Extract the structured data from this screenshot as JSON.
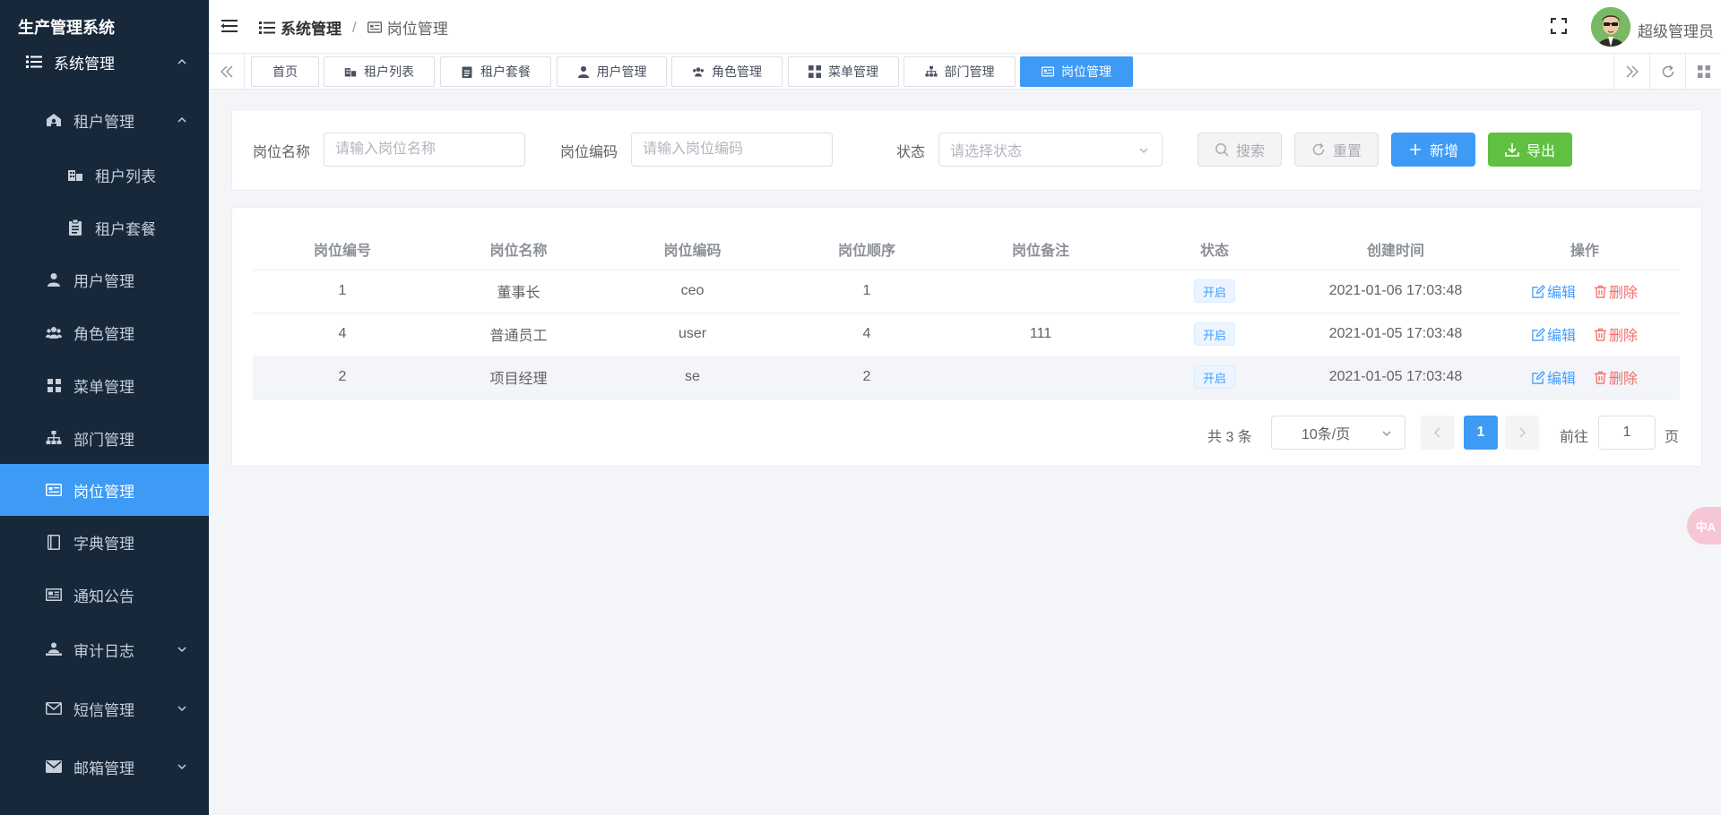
{
  "app": {
    "title": "生产管理系统"
  },
  "sidebar": {
    "top_menu": {
      "label": "系统管理"
    },
    "items": [
      {
        "id": "tenant",
        "label": "租户管理",
        "icon": "tenant-icon"
      },
      {
        "id": "tenant-list",
        "label": "租户列表",
        "icon": "tenant-list-icon"
      },
      {
        "id": "tenant-package",
        "label": "租户套餐",
        "icon": "clipboard-icon"
      },
      {
        "id": "user",
        "label": "用户管理",
        "icon": "user-icon"
      },
      {
        "id": "role",
        "label": "角色管理",
        "icon": "peoples-icon"
      },
      {
        "id": "menu",
        "label": "菜单管理",
        "icon": "grid-icon"
      },
      {
        "id": "dept",
        "label": "部门管理",
        "icon": "tree-icon"
      },
      {
        "id": "post",
        "label": "岗位管理",
        "icon": "post-icon"
      },
      {
        "id": "dict",
        "label": "字典管理",
        "icon": "dict-icon"
      },
      {
        "id": "notice",
        "label": "通知公告",
        "icon": "notice-icon"
      },
      {
        "id": "audit",
        "label": "审计日志",
        "icon": "log-icon"
      },
      {
        "id": "sms",
        "label": "短信管理",
        "icon": "message-icon"
      },
      {
        "id": "mail",
        "label": "邮箱管理",
        "icon": "email-icon"
      }
    ]
  },
  "header": {
    "breadcrumb": [
      "系统管理",
      "岗位管理"
    ],
    "breadcrumb_sep": "/",
    "username": "超级管理员"
  },
  "tags": [
    {
      "label": "首页",
      "icon": ""
    },
    {
      "label": "租户列表",
      "icon": "tenant-list-icon"
    },
    {
      "label": "租户套餐",
      "icon": "clipboard-icon"
    },
    {
      "label": "用户管理",
      "icon": "user-icon"
    },
    {
      "label": "角色管理",
      "icon": "peoples-icon"
    },
    {
      "label": "菜单管理",
      "icon": "grid-icon"
    },
    {
      "label": "部门管理",
      "icon": "tree-icon"
    },
    {
      "label": "岗位管理",
      "icon": "post-icon",
      "active": true
    }
  ],
  "search": {
    "post_name_label": "岗位名称",
    "post_name_placeholder": "请输入岗位名称",
    "post_code_label": "岗位编码",
    "post_code_placeholder": "请输入岗位编码",
    "status_label": "状态",
    "status_placeholder": "请选择状态",
    "search_btn": "搜索",
    "reset_btn": "重置",
    "add_btn": "新增",
    "export_btn": "导出"
  },
  "table": {
    "headers": [
      "岗位编号",
      "岗位名称",
      "岗位编码",
      "岗位顺序",
      "岗位备注",
      "状态",
      "创建时间",
      "操作"
    ],
    "rows": [
      {
        "id": "1",
        "name": "董事长",
        "code": "ceo",
        "sort": "1",
        "remark": "",
        "status": "开启",
        "created": "2021-01-06 17:03:48"
      },
      {
        "id": "4",
        "name": "普通员工",
        "code": "user",
        "sort": "4",
        "remark": "111",
        "status": "开启",
        "created": "2021-01-05 17:03:48"
      },
      {
        "id": "2",
        "name": "项目经理",
        "code": "se",
        "sort": "2",
        "remark": "",
        "status": "开启",
        "created": "2021-01-05 17:03:48"
      }
    ],
    "edit_label": "编辑",
    "delete_label": "删除"
  },
  "pagination": {
    "total_text": "共 3 条",
    "page_size": "10条/页",
    "current_page": "1",
    "goto_label": "前往",
    "goto_value": "1",
    "page_suffix": "页"
  },
  "translate_widget": {
    "label": "中A"
  },
  "colors": {
    "sidebar_bg": "#17283b",
    "accent": "#3d9af5",
    "success": "#5fc041",
    "danger": "#f56c6c"
  }
}
